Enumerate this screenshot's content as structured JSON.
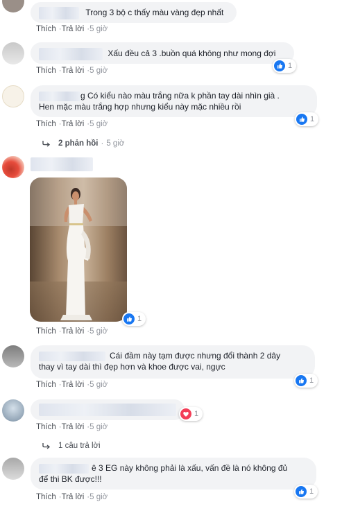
{
  "actions": {
    "like": "Thích",
    "reply": "Trả lời"
  },
  "comments": [
    {
      "text": "Trong 3 bộ c thấy màu vàng đẹp nhất",
      "time": "5 giờ"
    },
    {
      "text": "Xấu đều cả 3 .buồn quá không như mong đợi",
      "time": "5 giờ",
      "reaction_count": "1",
      "reaction_icon": "like-icon"
    },
    {
      "line1": "g Có kiểu nào màu trắng nữa k phần tay dài nhìn già .",
      "line2": "Hen mặc màu trắng hợp nhưng kiểu này mặc nhiều rồi",
      "time": "5 giờ",
      "reaction_count": "1",
      "reaction_icon": "like-icon",
      "replies_label": "2 phản hồi",
      "replies_time": "5 giờ"
    },
    {
      "time": "5 giờ",
      "reaction_count": "1",
      "reaction_icon": "like-icon",
      "image": "white-dress-photo"
    },
    {
      "line1": "Cái đầm này tạm được nhưng đổi thành 2 dây",
      "line2": "thay vì tay dài thì đẹp hơn và khoe được vai, ngực",
      "time": "5 giờ",
      "reaction_count": "1",
      "reaction_icon": "like-icon"
    },
    {
      "time": "5 giờ",
      "reaction_count": "1",
      "reaction_icon": "love-icon",
      "replies_label": "1 câu trả lời"
    },
    {
      "line1": "ê 3 EG này không phải là xấu, vấn đề là nó không đủ",
      "line2": "để thi BK được!!!",
      "time": "5 giờ",
      "reaction_count": "1",
      "reaction_icon": "like-icon"
    }
  ],
  "colors": {
    "like": "#1877f2",
    "love": "#f33e58",
    "bubble": "#f2f3f5"
  }
}
